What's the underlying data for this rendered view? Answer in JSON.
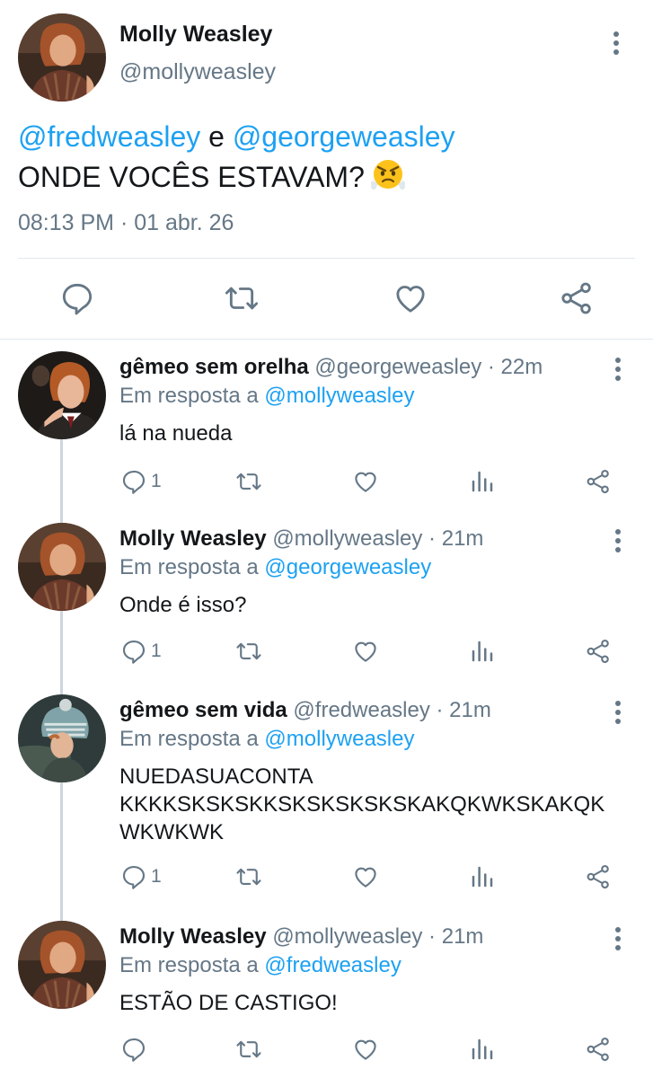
{
  "main_tweet": {
    "name": "Molly Weasley",
    "handle": "@mollyweasley",
    "mention_1": "@fredweasley",
    "conjunction": "e",
    "mention_2": "@georgeweasley",
    "text": "ONDE VOCÊS ESTAVAM?",
    "emoji": "angry-face-emoji",
    "timestamp": "08:13 PM · 01 abr. 26",
    "actions": [
      "reply-icon",
      "retweet-icon",
      "like-icon",
      "share-icon"
    ]
  },
  "replies": [
    {
      "name": "gêmeo sem orelha",
      "handle_time": "@georgeweasley · 22m",
      "reply_prefix": "Em resposta a",
      "reply_to": "@mollyweasley",
      "text_lines": [
        "lá na nueda"
      ],
      "reply_count": "1"
    },
    {
      "name": "Molly Weasley",
      "handle_time": "@mollyweasley · 21m",
      "reply_prefix": "Em resposta a",
      "reply_to": "@georgeweasley",
      "text_lines": [
        "Onde é isso?"
      ],
      "reply_count": "1"
    },
    {
      "name": "gêmeo sem vida",
      "handle_time": "@fredweasley · 21m",
      "reply_prefix": "Em resposta a",
      "reply_to": "@mollyweasley",
      "text_lines": [
        "NUEDASUACONTA",
        "KKKKSKSKSKKSKSKSKSKSKAKQKWKSKAKQK",
        "WKWKWK"
      ],
      "reply_count": "1"
    },
    {
      "name": "Molly Weasley",
      "handle_time": "@mollyweasley · 21m",
      "reply_prefix": "Em resposta a",
      "reply_to": "@fredweasley",
      "text_lines": [
        "ESTÃO DE CASTIGO!"
      ],
      "reply_count": ""
    }
  ],
  "colors": {
    "text": "#14171a",
    "secondary": "#657786",
    "link": "#1da1f2",
    "divider": "#e1e8ed",
    "thread_line": "#ccd6dd"
  }
}
